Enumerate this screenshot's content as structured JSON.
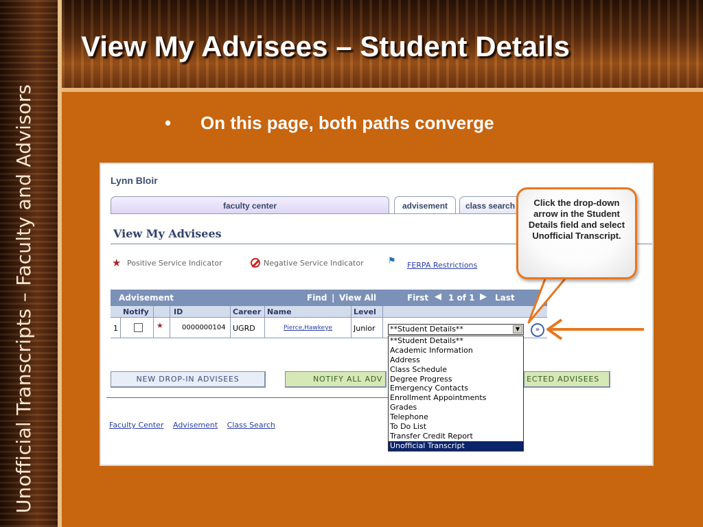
{
  "slide": {
    "title": "View My Advisees – Student Details",
    "side_title": "Unofficial Transcripts – Faculty and Advisors",
    "bullet": "•",
    "bullet_text": "On this page, both paths converge"
  },
  "screenshot": {
    "user_name": "Lynn Bloir",
    "tabs": [
      "faculty center",
      "advisement",
      "class search"
    ],
    "page_heading": "View My Advisees",
    "legend": {
      "positive": "Positive Service Indicator",
      "negative": "Negative Service Indicator",
      "ferpa": "FERPA Restrictions"
    },
    "grid": {
      "title": "Advisement",
      "find": "Find",
      "divider": "|",
      "view_all": "View All",
      "first": "First",
      "page_info": "1 of 1",
      "last": "Last",
      "columns": [
        "Notify",
        "ID",
        "Career",
        "Name",
        "Level"
      ],
      "row": {
        "num": "1",
        "id": "0000000104",
        "career": "UGRD",
        "name": "Pierce,Hawkeye",
        "level": "Junior"
      }
    },
    "student_details": {
      "selected": "**Student Details**",
      "options": [
        "**Student Details**",
        "Academic Information",
        "Address",
        "Class Schedule",
        "Degree Progress",
        "Emergency Contacts",
        "Enrollment Appointments",
        "Grades",
        "Telephone",
        "To Do List",
        "Transfer Credit Report",
        "Unofficial Transcript"
      ],
      "highlighted": "Unofficial Transcript"
    },
    "buttons": {
      "new_drop_in": "New Drop-In Advisees",
      "notify_all": "Notify All Adv",
      "notify_selected": "ected Advisees"
    },
    "footer_links": [
      "Faculty Center",
      "Advisement",
      "Class Search"
    ]
  },
  "callout": {
    "text": "Click the drop-down arrow in the Student Details field and select Unofficial Transcript."
  },
  "colors": {
    "background": "#c8650f",
    "accent_orange": "#e7771f",
    "grid_header": "#7b91b8",
    "highlight": "#0a246a"
  }
}
